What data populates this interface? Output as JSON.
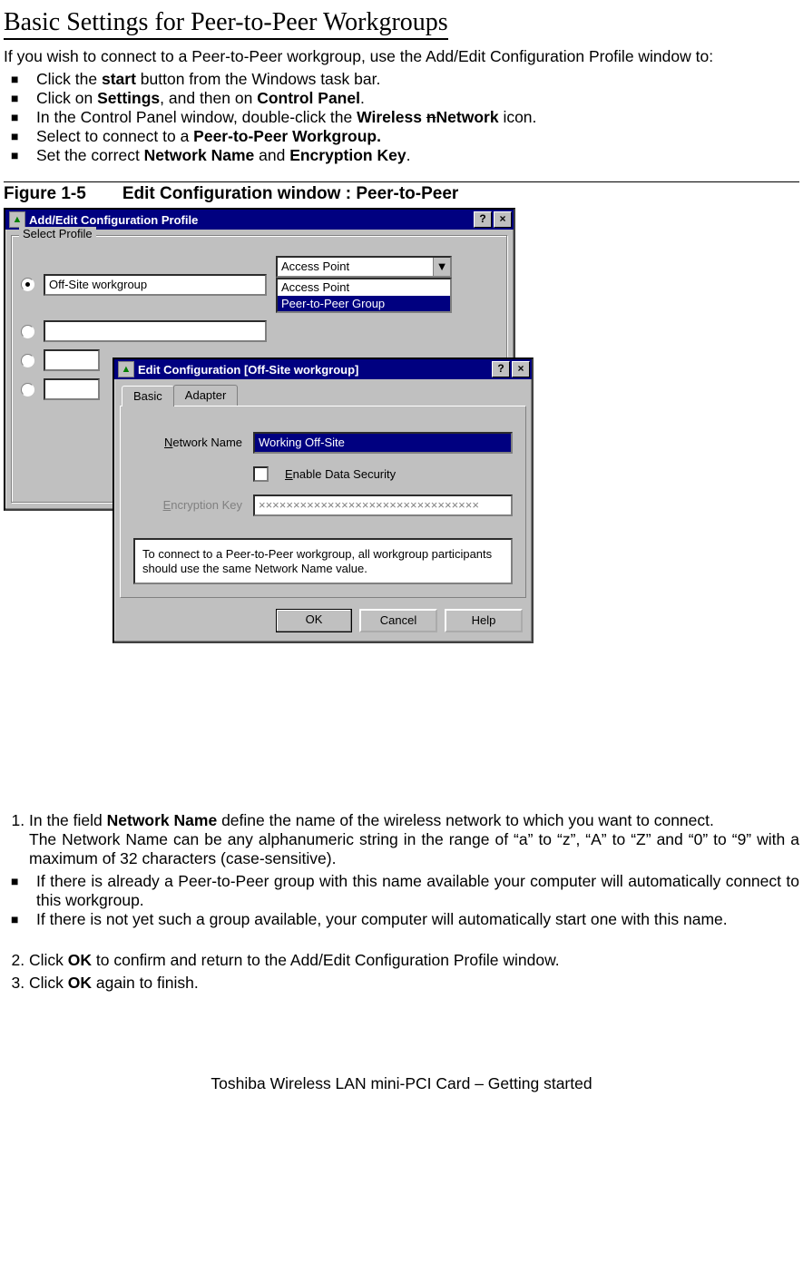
{
  "title": "Basic Settings for Peer-to-Peer Workgroups",
  "intro": "If you wish to connect to a Peer-to-Peer workgroup, use the Add/Edit Configuration Profile window to:",
  "bullets": [
    {
      "pre": "Click the ",
      "b": "start",
      "post": " button from the Windows task bar."
    },
    {
      "pre": "Click on ",
      "b": "Settings",
      "mid": ", and then on ",
      "b2": "Control Panel",
      "post": "."
    },
    {
      "pre": "In the Control Panel window, double-click the ",
      "b": "Wireless nNetwork",
      "post": " icon.",
      "strike_n": true
    },
    {
      "pre": "Select to connect to a ",
      "b": "Peer-to-Peer Workgroup.",
      "post": ""
    },
    {
      "pre": "Set the correct ",
      "b": "Network Name",
      "mid": " and ",
      "b2": "Encryption Key",
      "post": "."
    }
  ],
  "figure_label_a": "Figure 1-5",
  "figure_label_b": "Edit Configuration window : Peer-to-Peer",
  "win1": {
    "title": "Add/Edit Configuration Profile",
    "group": "Select Profile",
    "profile_value": "Off-Site workgroup",
    "combo_selected": "Access Point",
    "list": [
      "Access Point",
      "Peer-to-Peer Group"
    ]
  },
  "win2": {
    "title": "Edit Configuration [Off-Site workgroup]",
    "tabs": [
      "Basic",
      "Adapter"
    ],
    "network_name_label": "Network Name",
    "network_name_value": "Working Off-Site",
    "enable_security": "Enable Data Security",
    "encryption_label": "Encryption Key",
    "encryption_value": "××××××××××××××××××××××××××××××××",
    "help_text": "To connect to a Peer-to-Peer workgroup, all workgroup participants should use the same Network Name value.",
    "ok": "OK",
    "cancel": "Cancel",
    "help": "Help"
  },
  "step1": {
    "pre": "In the field ",
    "b": "Network Name",
    "post": " define the name of the wireless network to which you want to connect.",
    "line2": "The Network Name can be any alphanumeric string in the range of  “a” to “z”, “A” to “Z” and “0” to “9” with a maximum of 32 characters (case-sensitive)."
  },
  "step1_bul": [
    "If there is already a Peer-to-Peer group with this name available your computer will automatically connect to this workgroup.",
    "If there is not yet such a group available, your computer will automatically start one with this name."
  ],
  "step2": {
    "pre": "Click ",
    "b": "OK",
    "post": " to confirm and return to the Add/Edit Configuration Profile window."
  },
  "step3": {
    "pre": "Click ",
    "b": "OK",
    "post": " again to finish."
  },
  "footer": "Toshiba Wireless LAN mini-PCI Card – Getting started"
}
